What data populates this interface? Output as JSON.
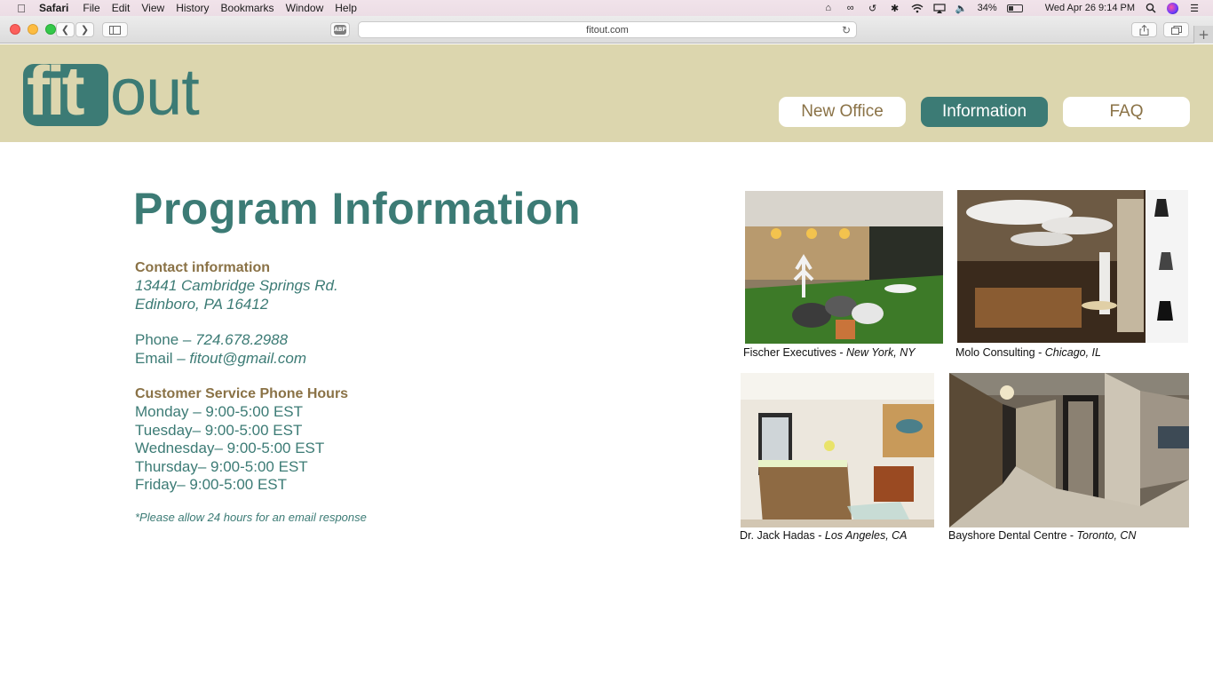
{
  "menubar": {
    "app": "Safari",
    "items": [
      "File",
      "Edit",
      "View",
      "History",
      "Bookmarks",
      "Window",
      "Help"
    ],
    "battery": "34%",
    "battery_level": 0.34,
    "clock": "Wed Apr 26  9:14 PM"
  },
  "browser": {
    "url": "fitout.com",
    "adblock_label": "ABP"
  },
  "logo": {
    "fit": "fit",
    "out": "out"
  },
  "nav": [
    {
      "label": "New Office",
      "active": false
    },
    {
      "label": "Information",
      "active": true
    },
    {
      "label": "FAQ",
      "active": false
    }
  ],
  "page": {
    "title": "Program Information",
    "contact_heading": "Contact information",
    "address_line1": "13441 Cambridge Springs Rd.",
    "address_line2": "Edinboro, PA 16412",
    "phone_label": "Phone – ",
    "phone": "724.678.2988",
    "email_label": "Email – ",
    "email": "fitout@gmail.com",
    "hours_heading": "Customer Service Phone Hours",
    "hours": [
      "Monday – 9:00-5:00 EST",
      "Tuesday– 9:00-5:00 EST",
      "Wednesday– 9:00-5:00 EST",
      "Thursday– 9:00-5:00 EST",
      "Friday– 9:00-5:00 EST"
    ],
    "note": "*Please allow 24 hours for an email response"
  },
  "gallery": [
    {
      "name": "Fischer Executives",
      "sep": " - ",
      "location": "New York, NY"
    },
    {
      "name": "Molo Consulting",
      "sep": " - ",
      "location": "Chicago, IL"
    },
    {
      "name": "Dr. Jack Hadas",
      "sep": " - ",
      "location": "Los Angeles, CA"
    },
    {
      "name": "Bayshore Dental Centre",
      "sep": " - ",
      "location": "Toronto, CN"
    }
  ],
  "colors": {
    "teal": "#3c7b75",
    "tan": "#dcd6ae",
    "brown": "#8a7246"
  }
}
